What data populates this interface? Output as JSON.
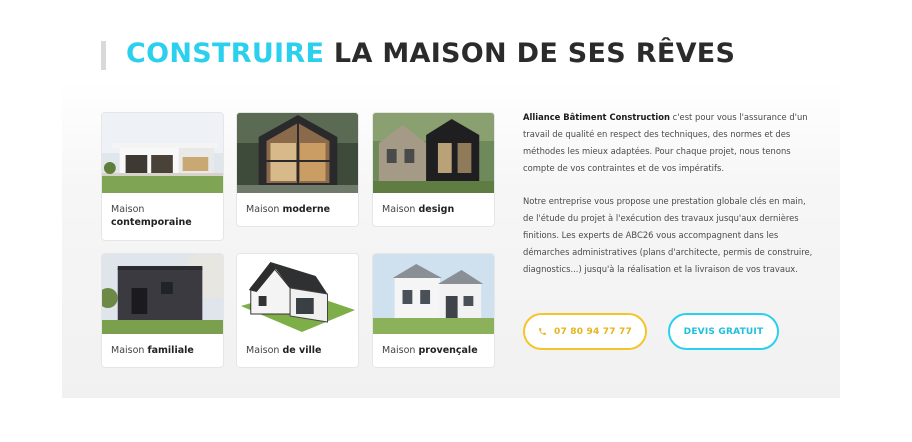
{
  "heading": {
    "accent": "CONSTRUIRE",
    "rest": " LA MAISON DE SES RÊVES"
  },
  "cards": [
    {
      "prefix": "Maison",
      "bold": "contemporaine",
      "image": "contemporary-house-photo"
    },
    {
      "prefix": "Maison",
      "bold": "moderne",
      "image": "modern-house-photo"
    },
    {
      "prefix": "Maison",
      "bold": "design",
      "image": "design-house-photo"
    },
    {
      "prefix": "Maison",
      "bold": "familiale",
      "image": "family-house-photo"
    },
    {
      "prefix": "Maison",
      "bold": "de ville",
      "image": "town-house-photo"
    },
    {
      "prefix": "Maison",
      "bold": "provençale",
      "image": "provencal-house-photo"
    }
  ],
  "intro": {
    "brand": "Alliance Bâtiment Construction",
    "p1_rest": " c'est pour vous l'assurance d'un travail de qualité en respect des techniques, des normes et des méthodes les mieux adaptées. Pour chaque projet, nous tenons compte de vos contraintes et de vos impératifs.",
    "p2": "Notre entreprise vous propose une prestation globale clés en main, de l'étude du projet à l'exécution des travaux jusqu'aux dernières finitions. Les experts de ABC26 vous accompagnent dans les démarches administratives (plans d'architecte, permis de construire, diagnostics...) jusqu'à la réalisation et la livraison de vos travaux."
  },
  "buttons": {
    "phone_label": "07 80 94 77 77",
    "quote_label": "DEVIS GRATUIT"
  },
  "colors": {
    "accent": "#2ad0ee",
    "phone": "#f4c52a",
    "heading": "#2b2b2b"
  }
}
